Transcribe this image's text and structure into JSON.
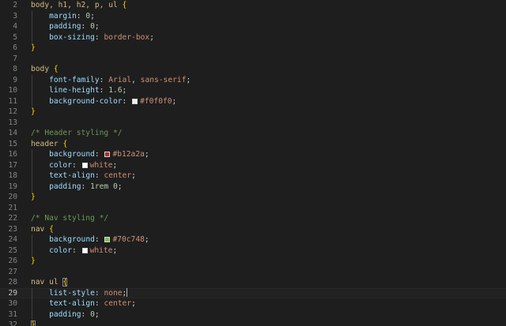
{
  "editor": {
    "lines": [
      {
        "num": "2",
        "indent": false,
        "tokens": [
          {
            "t": "body, h1, h2, p, ul ",
            "c": "sel"
          },
          {
            "t": "{",
            "c": "brace"
          }
        ]
      },
      {
        "num": "3",
        "indent": true,
        "tokens": [
          {
            "t": "    ",
            "c": "punc"
          },
          {
            "t": "margin",
            "c": "prop"
          },
          {
            "t": ": ",
            "c": "punc"
          },
          {
            "t": "0",
            "c": "num"
          },
          {
            "t": ";",
            "c": "punc"
          }
        ]
      },
      {
        "num": "4",
        "indent": true,
        "tokens": [
          {
            "t": "    ",
            "c": "punc"
          },
          {
            "t": "padding",
            "c": "prop"
          },
          {
            "t": ": ",
            "c": "punc"
          },
          {
            "t": "0",
            "c": "num"
          },
          {
            "t": ";",
            "c": "punc"
          }
        ]
      },
      {
        "num": "5",
        "indent": true,
        "tokens": [
          {
            "t": "    ",
            "c": "punc"
          },
          {
            "t": "box-sizing",
            "c": "prop"
          },
          {
            "t": ": ",
            "c": "punc"
          },
          {
            "t": "border-box",
            "c": "val"
          },
          {
            "t": ";",
            "c": "punc"
          }
        ]
      },
      {
        "num": "6",
        "indent": false,
        "tokens": [
          {
            "t": "}",
            "c": "brace"
          }
        ]
      },
      {
        "num": "7",
        "indent": false,
        "tokens": []
      },
      {
        "num": "8",
        "indent": false,
        "tokens": [
          {
            "t": "body ",
            "c": "sel"
          },
          {
            "t": "{",
            "c": "brace"
          }
        ]
      },
      {
        "num": "9",
        "indent": true,
        "tokens": [
          {
            "t": "    ",
            "c": "punc"
          },
          {
            "t": "font-family",
            "c": "prop"
          },
          {
            "t": ": ",
            "c": "punc"
          },
          {
            "t": "Arial",
            "c": "val"
          },
          {
            "t": ", ",
            "c": "punc"
          },
          {
            "t": "sans-serif",
            "c": "val"
          },
          {
            "t": ";",
            "c": "punc"
          }
        ]
      },
      {
        "num": "10",
        "indent": true,
        "tokens": [
          {
            "t": "    ",
            "c": "punc"
          },
          {
            "t": "line-height",
            "c": "prop"
          },
          {
            "t": ": ",
            "c": "punc"
          },
          {
            "t": "1.6",
            "c": "num"
          },
          {
            "t": ";",
            "c": "punc"
          }
        ]
      },
      {
        "num": "11",
        "indent": true,
        "tokens": [
          {
            "t": "    ",
            "c": "punc"
          },
          {
            "t": "background-color",
            "c": "prop"
          },
          {
            "t": ": ",
            "c": "punc"
          },
          {
            "swatch": "#f0f0f0"
          },
          {
            "t": "#f0f0f0",
            "c": "val"
          },
          {
            "t": ";",
            "c": "punc"
          }
        ]
      },
      {
        "num": "12",
        "indent": false,
        "tokens": [
          {
            "t": "}",
            "c": "brace"
          }
        ]
      },
      {
        "num": "13",
        "indent": false,
        "tokens": []
      },
      {
        "num": "14",
        "indent": false,
        "tokens": [
          {
            "t": "/* Header styling */",
            "c": "com"
          }
        ]
      },
      {
        "num": "15",
        "indent": false,
        "tokens": [
          {
            "t": "header ",
            "c": "sel"
          },
          {
            "t": "{",
            "c": "brace"
          }
        ]
      },
      {
        "num": "16",
        "indent": true,
        "tokens": [
          {
            "t": "    ",
            "c": "punc"
          },
          {
            "t": "background",
            "c": "prop"
          },
          {
            "t": ": ",
            "c": "punc"
          },
          {
            "swatch": "#b12a2a"
          },
          {
            "t": "#b12a2a",
            "c": "val"
          },
          {
            "t": ";",
            "c": "punc"
          }
        ]
      },
      {
        "num": "17",
        "indent": true,
        "tokens": [
          {
            "t": "    ",
            "c": "punc"
          },
          {
            "t": "color",
            "c": "prop"
          },
          {
            "t": ": ",
            "c": "punc"
          },
          {
            "swatch": "#ffffff"
          },
          {
            "t": "white",
            "c": "val"
          },
          {
            "t": ";",
            "c": "punc"
          }
        ]
      },
      {
        "num": "18",
        "indent": true,
        "tokens": [
          {
            "t": "    ",
            "c": "punc"
          },
          {
            "t": "text-align",
            "c": "prop"
          },
          {
            "t": ": ",
            "c": "punc"
          },
          {
            "t": "center",
            "c": "val"
          },
          {
            "t": ";",
            "c": "punc"
          }
        ]
      },
      {
        "num": "19",
        "indent": true,
        "tokens": [
          {
            "t": "    ",
            "c": "punc"
          },
          {
            "t": "padding",
            "c": "prop"
          },
          {
            "t": ": ",
            "c": "punc"
          },
          {
            "t": "1rem",
            "c": "num"
          },
          {
            "t": " ",
            "c": "punc"
          },
          {
            "t": "0",
            "c": "num"
          },
          {
            "t": ";",
            "c": "punc"
          }
        ]
      },
      {
        "num": "20",
        "indent": false,
        "tokens": [
          {
            "t": "}",
            "c": "brace"
          }
        ]
      },
      {
        "num": "21",
        "indent": false,
        "tokens": []
      },
      {
        "num": "22",
        "indent": false,
        "tokens": [
          {
            "t": "/* Nav styling */",
            "c": "com"
          }
        ]
      },
      {
        "num": "23",
        "indent": false,
        "tokens": [
          {
            "t": "nav ",
            "c": "sel"
          },
          {
            "t": "{",
            "c": "brace"
          }
        ]
      },
      {
        "num": "24",
        "indent": true,
        "tokens": [
          {
            "t": "    ",
            "c": "punc"
          },
          {
            "t": "background",
            "c": "prop"
          },
          {
            "t": ": ",
            "c": "punc"
          },
          {
            "swatch": "#70c748"
          },
          {
            "t": "#70c748",
            "c": "val"
          },
          {
            "t": ";",
            "c": "punc"
          }
        ]
      },
      {
        "num": "25",
        "indent": true,
        "tokens": [
          {
            "t": "    ",
            "c": "punc"
          },
          {
            "t": "color",
            "c": "prop"
          },
          {
            "t": ": ",
            "c": "punc"
          },
          {
            "swatch": "#ffffff"
          },
          {
            "t": "white",
            "c": "val"
          },
          {
            "t": ";",
            "c": "punc"
          }
        ]
      },
      {
        "num": "26",
        "indent": false,
        "tokens": [
          {
            "t": "}",
            "c": "brace"
          }
        ]
      },
      {
        "num": "27",
        "indent": false,
        "tokens": []
      },
      {
        "num": "28",
        "indent": false,
        "tokens": [
          {
            "t": "nav ul ",
            "c": "sel"
          },
          {
            "t": "{",
            "c": "brace",
            "match": true
          }
        ]
      },
      {
        "num": "29",
        "indent": true,
        "current": true,
        "tokens": [
          {
            "t": "    ",
            "c": "punc"
          },
          {
            "t": "list-style",
            "c": "prop"
          },
          {
            "t": ": ",
            "c": "punc"
          },
          {
            "t": "none",
            "c": "val"
          },
          {
            "t": ";",
            "c": "punc"
          },
          {
            "cursor": true
          }
        ]
      },
      {
        "num": "30",
        "indent": true,
        "tokens": [
          {
            "t": "    ",
            "c": "punc"
          },
          {
            "t": "text-align",
            "c": "prop"
          },
          {
            "t": ": ",
            "c": "punc"
          },
          {
            "t": "center",
            "c": "val"
          },
          {
            "t": ";",
            "c": "punc"
          }
        ]
      },
      {
        "num": "31",
        "indent": true,
        "tokens": [
          {
            "t": "    ",
            "c": "punc"
          },
          {
            "t": "padding",
            "c": "prop"
          },
          {
            "t": ": ",
            "c": "punc"
          },
          {
            "t": "0",
            "c": "num"
          },
          {
            "t": ";",
            "c": "punc"
          }
        ]
      },
      {
        "num": "32",
        "indent": false,
        "tokens": [
          {
            "t": "}",
            "c": "brace",
            "match": true
          }
        ]
      }
    ]
  }
}
